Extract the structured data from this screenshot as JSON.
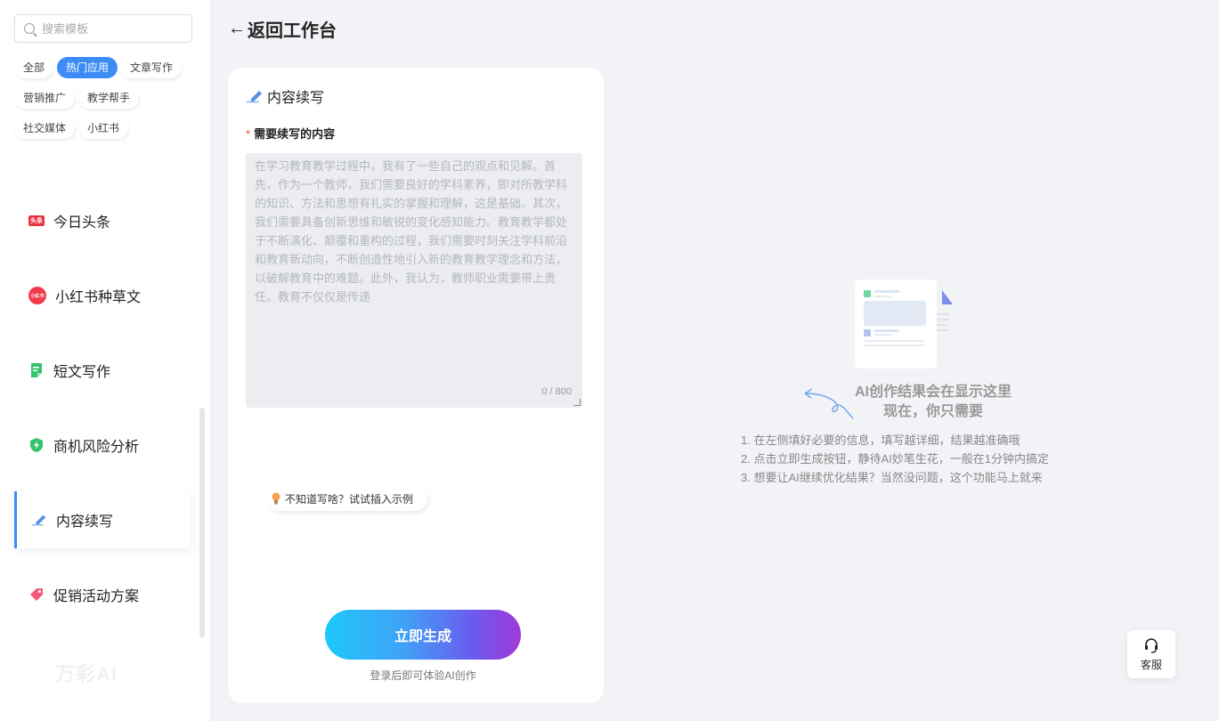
{
  "sidebar": {
    "search_placeholder": "搜索模板",
    "chips": [
      "全部",
      "热门应用",
      "文章写作",
      "营销推广",
      "教学帮手",
      "社交媒体",
      "小红书"
    ],
    "active_chip": "热门应用",
    "items": [
      {
        "label": "今日头条",
        "icon": "toutiao-icon",
        "icon_text": "头条"
      },
      {
        "label": "小红书种草文",
        "icon": "xiaohongshu-icon",
        "icon_text": "小红书"
      },
      {
        "label": "短文写作",
        "icon": "note-icon"
      },
      {
        "label": "商机风险分析",
        "icon": "shield-icon"
      },
      {
        "label": "内容续写",
        "icon": "pen-icon"
      },
      {
        "label": "促销活动方案",
        "icon": "tag-icon"
      }
    ],
    "active_item": "内容续写",
    "brand": "万彩AI"
  },
  "header": {
    "back_arrow": "←",
    "back_label": "返回工作台"
  },
  "form": {
    "title": "内容续写",
    "field_required_mark": "*",
    "field_label": "需要续写的内容",
    "textarea_placeholder": "在学习教育教学过程中，我有了一些自己的观点和见解。首先，作为一个教师，我们需要良好的学科素养，即对所教学科的知识、方法和思想有扎实的掌握和理解，这是基础。其次，我们需要具备创新思维和敏锐的变化感知能力。教育教学都处于不断演化、颠覆和重构的过程，我们需要时刻关注学科前沿和教育新动向，不断创造性地引入新的教育教学理念和方法，以破解教育中的难题。此外，我认为，教师职业需要带上责任。教育不仅仅是传递",
    "counter": "0 / 800",
    "tip": "不知道写啥？试试插入示例",
    "generate_label": "立即生成",
    "login_tip": "登录后即可体验AI创作"
  },
  "result": {
    "title_line1": "AI创作结果会在显示这里",
    "title_line2": "现在，你只需要",
    "steps": [
      "1. 在左侧填好必要的信息，填写越详细，结果越准确哦",
      "2. 点击立即生成按钮，静待AI妙笔生花，一般在1分钟内搞定",
      "3. 想要让AI继续优化结果？当然没问题，这个功能马上就来"
    ]
  },
  "service": {
    "label": "客服"
  },
  "colors": {
    "accent": "#3d8cf6",
    "required": "#e74c3c",
    "toutiao": "#e8333f",
    "xiaohongshu": "#f23a4d",
    "green": "#34c26b"
  }
}
